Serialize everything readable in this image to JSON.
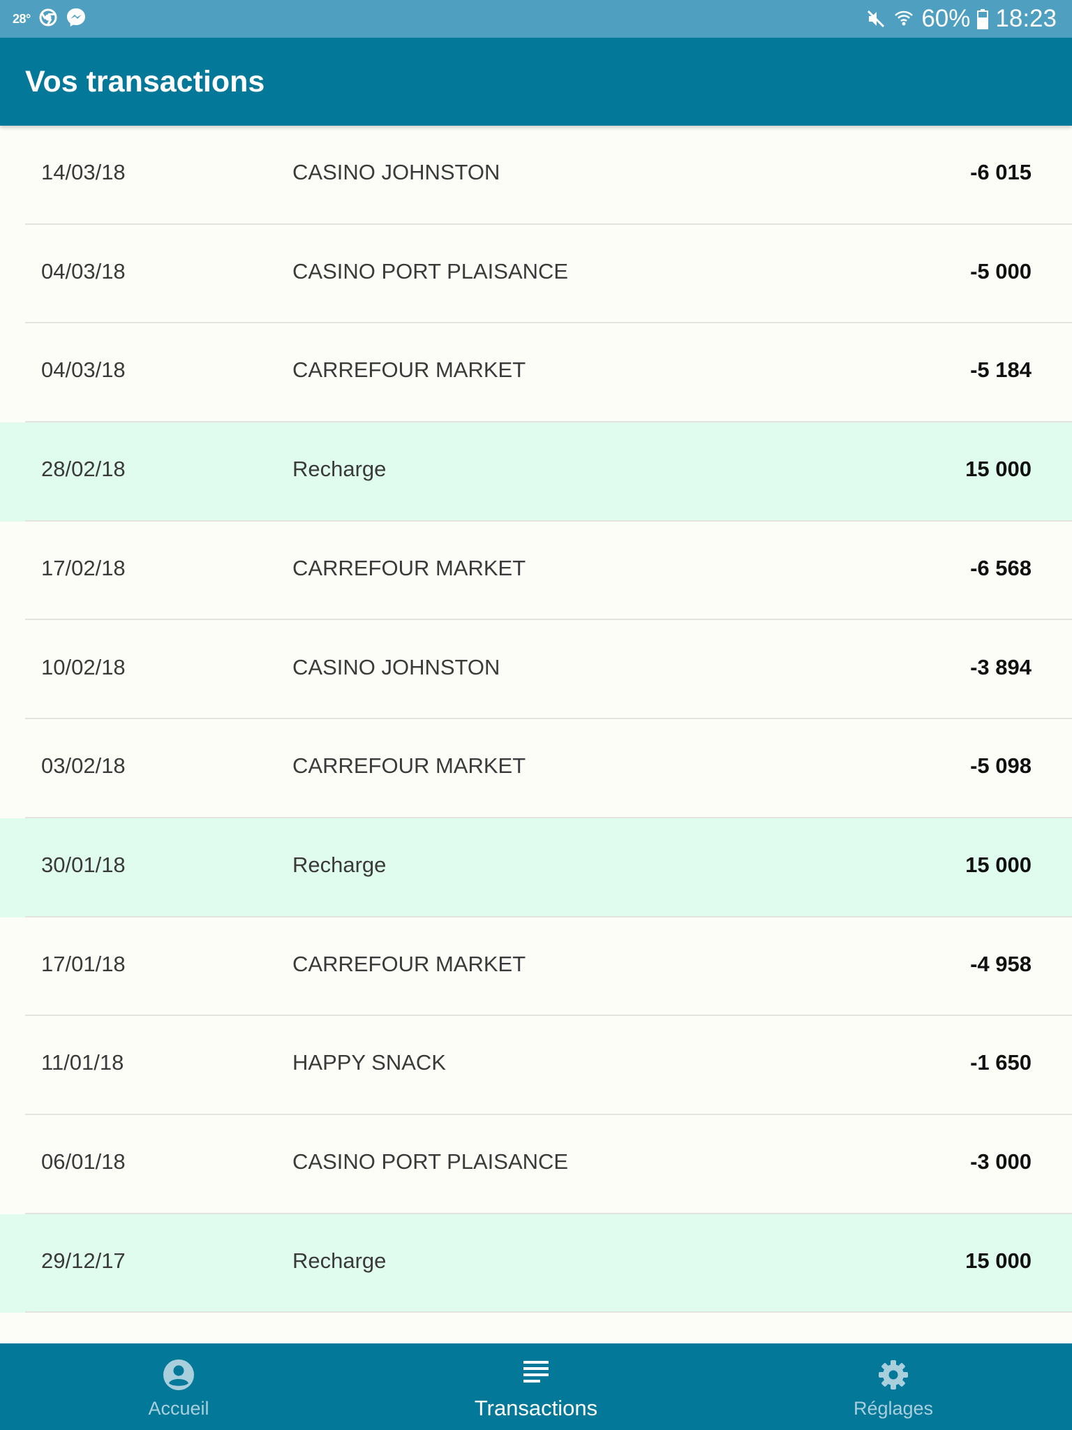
{
  "status_bar": {
    "temperature": "28°",
    "battery": "60%",
    "time": "18:23",
    "icons": [
      "chrome-icon",
      "messenger-icon",
      "mute-icon",
      "wifi-icon",
      "battery-icon"
    ]
  },
  "header": {
    "title": "Vos transactions"
  },
  "transactions": [
    {
      "date": "14/03/18",
      "label": "CASINO JOHNSTON",
      "amount": "-6 015",
      "type": "debit"
    },
    {
      "date": "04/03/18",
      "label": "CASINO PORT PLAISANCE",
      "amount": "-5 000",
      "type": "debit"
    },
    {
      "date": "04/03/18",
      "label": "CARREFOUR MARKET",
      "amount": "-5 184",
      "type": "debit"
    },
    {
      "date": "28/02/18",
      "label": "Recharge",
      "amount": "15 000",
      "type": "recharge"
    },
    {
      "date": "17/02/18",
      "label": "CARREFOUR MARKET",
      "amount": "-6 568",
      "type": "debit"
    },
    {
      "date": "10/02/18",
      "label": "CASINO JOHNSTON",
      "amount": "-3 894",
      "type": "debit"
    },
    {
      "date": "03/02/18",
      "label": "CARREFOUR MARKET",
      "amount": "-5 098",
      "type": "debit"
    },
    {
      "date": "30/01/18",
      "label": "Recharge",
      "amount": "15 000",
      "type": "recharge"
    },
    {
      "date": "17/01/18",
      "label": "CARREFOUR MARKET",
      "amount": "-4 958",
      "type": "debit"
    },
    {
      "date": "11/01/18",
      "label": "HAPPY SNACK",
      "amount": "-1 650",
      "type": "debit"
    },
    {
      "date": "06/01/18",
      "label": "CASINO PORT PLAISANCE",
      "amount": "-3 000",
      "type": "debit"
    },
    {
      "date": "29/12/17",
      "label": "Recharge",
      "amount": "15 000",
      "type": "recharge"
    }
  ],
  "bottom_nav": {
    "items": [
      {
        "label": "Accueil",
        "icon": "account-circle-icon",
        "active": false
      },
      {
        "label": "Transactions",
        "icon": "list-icon",
        "active": true
      },
      {
        "label": "Réglages",
        "icon": "gear-icon",
        "active": false
      }
    ]
  },
  "colors": {
    "status_bar": "#4e9fc0",
    "app_bar": "#037899",
    "recharge_row": "#e0fcef",
    "debit_row": "#fdfdf8"
  }
}
